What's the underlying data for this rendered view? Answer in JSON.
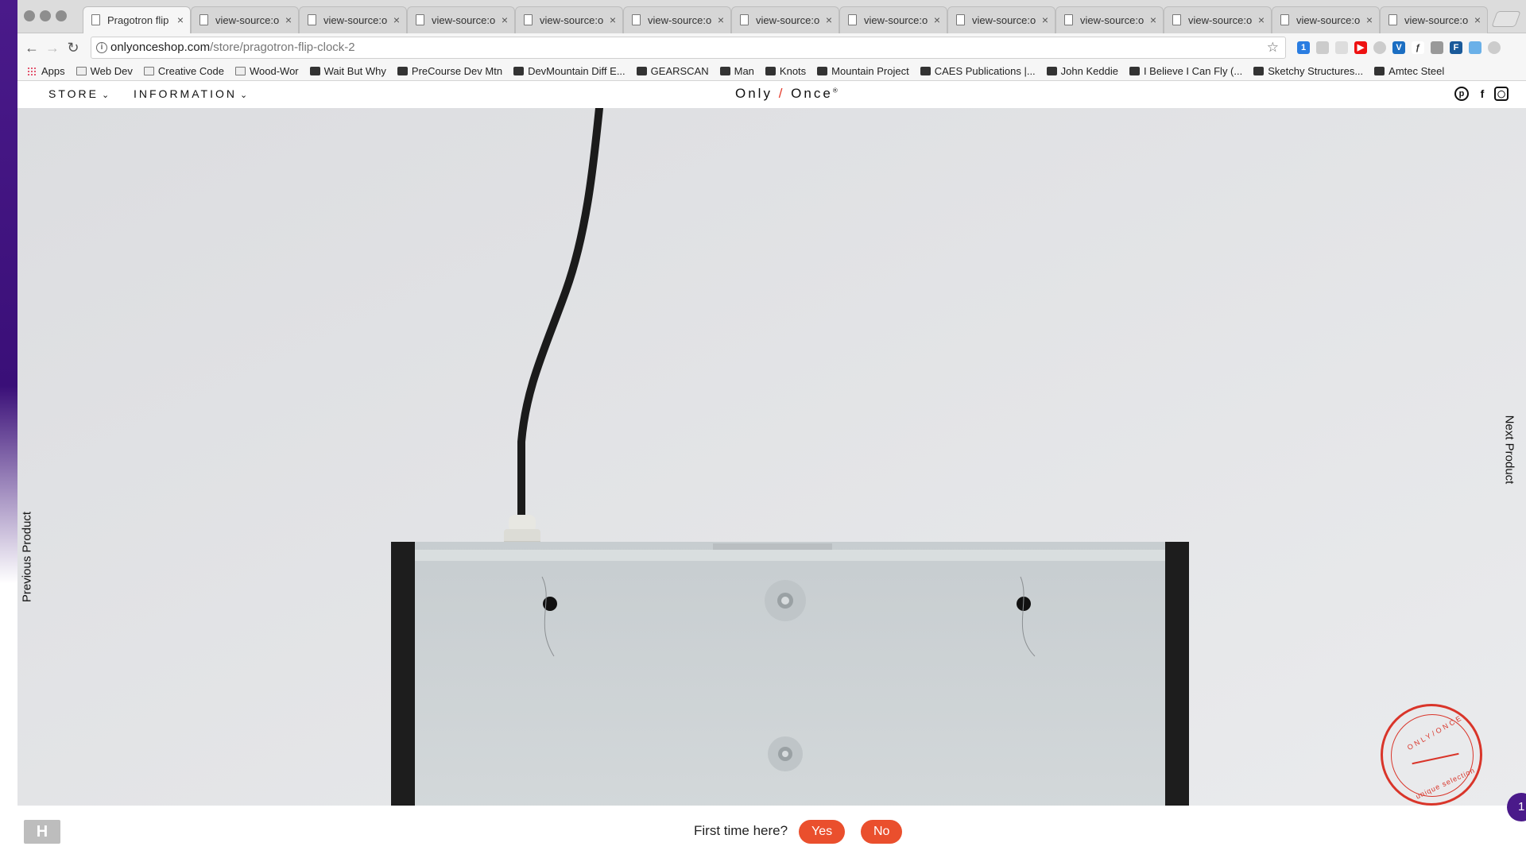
{
  "browser": {
    "tabs": [
      {
        "label": "Pragotron flip",
        "active": true
      },
      {
        "label": "view-source:o"
      },
      {
        "label": "view-source:o"
      },
      {
        "label": "view-source:o"
      },
      {
        "label": "view-source:o"
      },
      {
        "label": "view-source:o"
      },
      {
        "label": "view-source:o"
      },
      {
        "label": "view-source:o"
      },
      {
        "label": "view-source:o"
      },
      {
        "label": "view-source:o"
      },
      {
        "label": "view-source:o"
      },
      {
        "label": "view-source:o"
      },
      {
        "label": "view-source:o"
      }
    ],
    "address": {
      "domain": "onlyonceshop.com",
      "path": "/store/pragotron-flip-clock-2"
    },
    "extension_badge": "1",
    "bookmarks": [
      {
        "label": "Apps",
        "icon": "apps-grid-icon"
      },
      {
        "label": "Web Dev",
        "icon": "folder-icon"
      },
      {
        "label": "Creative Code",
        "icon": "folder-icon"
      },
      {
        "label": "Wood-Wor",
        "icon": "folder-icon"
      },
      {
        "label": "Wait But Why",
        "icon": "site-icon"
      },
      {
        "label": "PreCourse Dev Mtn",
        "icon": "site-icon"
      },
      {
        "label": "DevMountain Diff E...",
        "icon": "site-icon"
      },
      {
        "label": "GEARSCAN",
        "icon": "site-icon"
      },
      {
        "label": "Man",
        "icon": "site-icon"
      },
      {
        "label": "Knots",
        "icon": "site-icon"
      },
      {
        "label": "Mountain Project",
        "icon": "site-icon"
      },
      {
        "label": "CAES Publications |...",
        "icon": "site-icon"
      },
      {
        "label": "John Keddie",
        "icon": "site-icon"
      },
      {
        "label": "I Believe I Can Fly (...",
        "icon": "site-icon"
      },
      {
        "label": "Sketchy Structures...",
        "icon": "site-icon"
      },
      {
        "label": "Amtec Steel",
        "icon": "site-icon"
      }
    ]
  },
  "site": {
    "nav": {
      "store": "STORE",
      "information": "INFORMATION"
    },
    "logo": {
      "left": "Only",
      "slash": "/",
      "right": "Once",
      "mark": "®"
    },
    "social": [
      "pinterest-icon",
      "facebook-icon",
      "instagram-icon"
    ],
    "hero": {
      "prev_label": "Previous Product",
      "next_label": "Next Product"
    },
    "stamp": {
      "top_text": "ONLY/ONCE",
      "bottom_text": "unique selection"
    },
    "footer": {
      "logo_text": "H",
      "prompt": "First time here?",
      "yes": "Yes",
      "no": "No",
      "chat_badge": "1"
    }
  },
  "colors": {
    "accent": "#ea4f2d",
    "stamp": "#d9352a",
    "hero_bg": "#e4e5e7"
  }
}
